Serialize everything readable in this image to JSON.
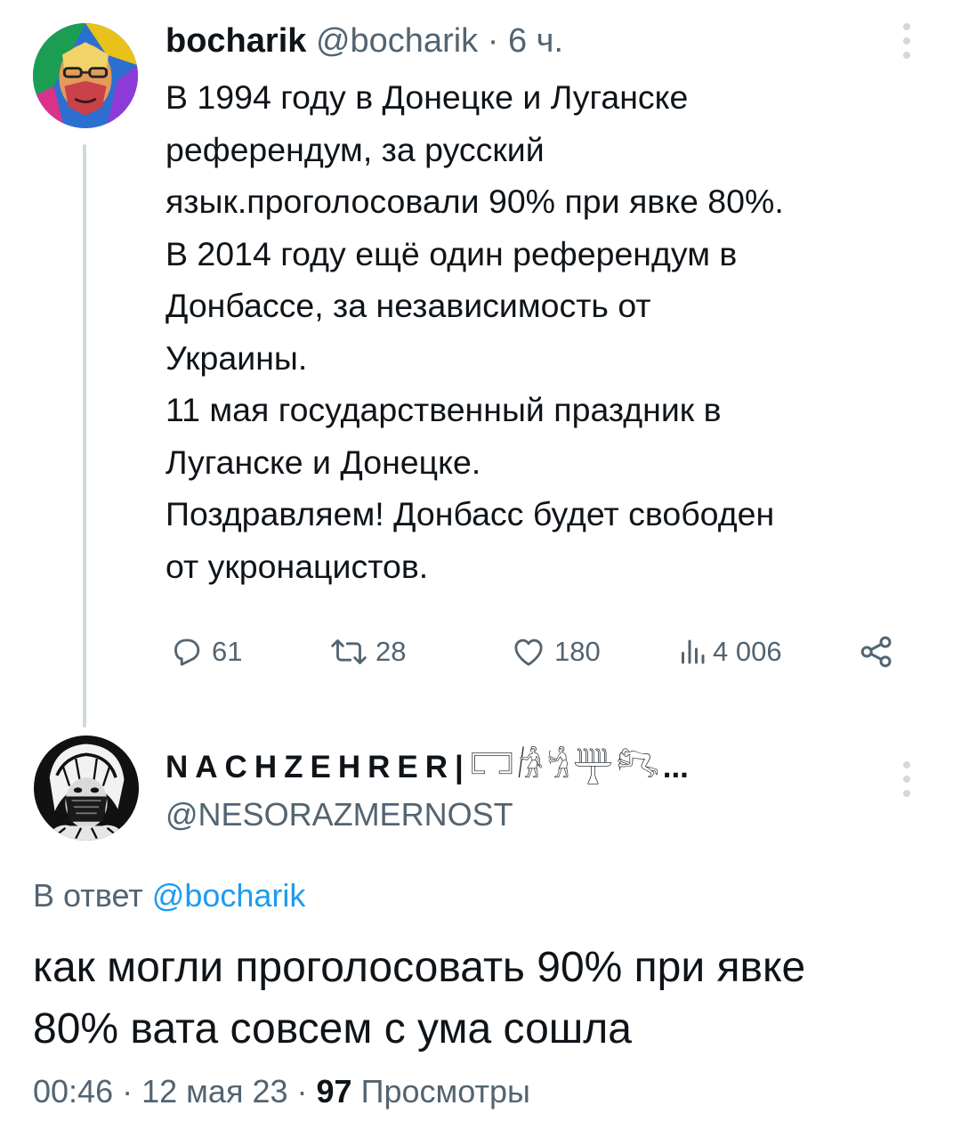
{
  "tweet": {
    "author": {
      "display_name": "bocharik",
      "handle": "@bocharik",
      "avatar_icon": "pop-art-portrait-avatar"
    },
    "separator": "·",
    "time": "6 ч.",
    "text_lines": [
      "В 1994 году в Донецке и Луганске",
      "референдум,  за  русский",
      "язык.проголосовали 90% при явке 80%.",
      "В 2014 году ещё один референдум в",
      "Донбассе, за независимость от",
      "Украины.",
      "11 мая государственный праздник в",
      "Луганске и Донецке.",
      "Поздравляем! Донбасс будет свободен",
      "от укронацистов."
    ],
    "actions": {
      "replies": "61",
      "retweets": "28",
      "likes": "180",
      "views": "4 006"
    }
  },
  "reply": {
    "author": {
      "display_name": "NACHZEHRER|",
      "name_glyphs": "𓉐𓀙𓀜𓊰𓀐",
      "ellipsis": "...",
      "handle": "@NESORAZMERNOST",
      "avatar_icon": "dark-sketch-portrait-avatar"
    },
    "reply_prefix": "В ответ",
    "reply_mention": "@bocharik",
    "text_lines": [
      "как могли проголосовать 90% при явке",
      "80% вата совсем с ума сошла"
    ],
    "time": "00:46",
    "separator": "·",
    "date": "12 мая 23",
    "views_count": "97",
    "views_label": "Просмотры"
  },
  "colors": {
    "text": "#0f1419",
    "secondary": "#536471",
    "link": "#1d9bf0",
    "border": "#cfd9de"
  }
}
